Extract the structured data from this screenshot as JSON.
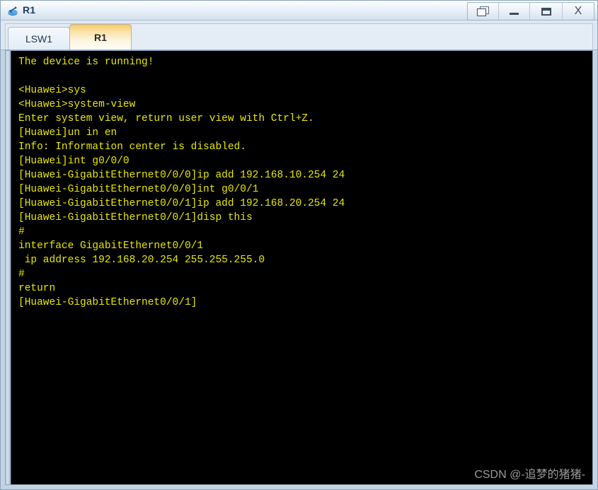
{
  "window": {
    "title": "R1",
    "icon": "router-icon",
    "controls": [
      {
        "name": "restore-button",
        "label": "",
        "icon": "restore-icon"
      },
      {
        "name": "minimize-button",
        "label": "",
        "icon": "minimize-icon"
      },
      {
        "name": "maximize-button",
        "label": "",
        "icon": "maximize-icon"
      },
      {
        "name": "close-button",
        "label": "X",
        "icon": "close-icon"
      }
    ]
  },
  "tabs": [
    {
      "label": "LSW1",
      "active": false
    },
    {
      "label": "R1",
      "active": true
    }
  ],
  "terminal": {
    "background_color": "#000000",
    "text_color": "#e8e800",
    "lines": [
      "The device is running!",
      "",
      "<Huawei>sys",
      "<Huawei>system-view",
      "Enter system view, return user view with Ctrl+Z.",
      "[Huawei]un in en",
      "Info: Information center is disabled.",
      "[Huawei]int g0/0/0",
      "[Huawei-GigabitEthernet0/0/0]ip add 192.168.10.254 24",
      "[Huawei-GigabitEthernet0/0/0]int g0/0/1",
      "[Huawei-GigabitEthernet0/0/1]ip add 192.168.20.254 24",
      "[Huawei-GigabitEthernet0/0/1]disp this",
      "#",
      "interface GigabitEthernet0/0/1",
      " ip address 192.168.20.254 255.255.255.0",
      "#",
      "return",
      "[Huawei-GigabitEthernet0/0/1]"
    ]
  },
  "watermark": {
    "text": "CSDN @-追梦的猪猪-"
  }
}
